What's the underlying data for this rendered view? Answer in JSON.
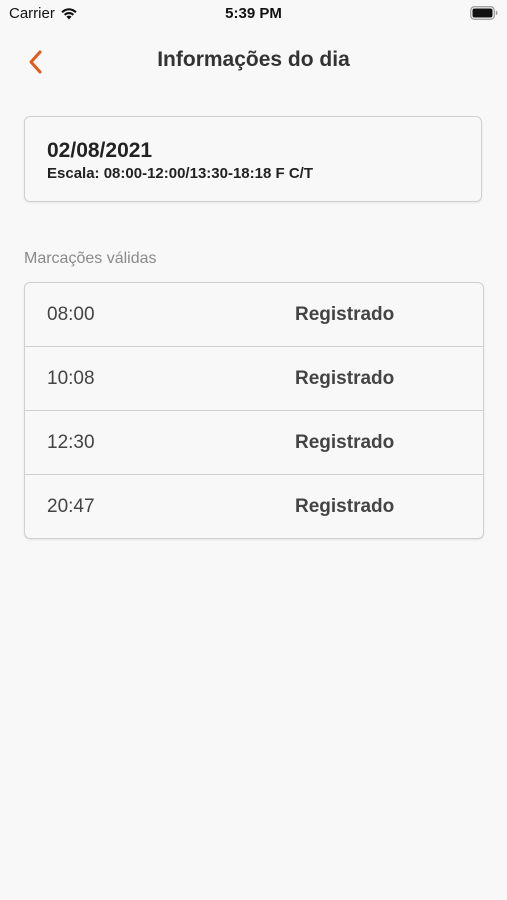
{
  "status_bar": {
    "carrier": "Carrier",
    "time": "5:39 PM",
    "icons": [
      "wifi-icon",
      "battery-icon"
    ]
  },
  "nav": {
    "title": "Informações do dia",
    "back_icon": "chevron-left-icon",
    "accent_color": "#e05a1e"
  },
  "info": {
    "date": "02/08/2021",
    "escala": "Escala: 08:00-12:00/13:30-18:18 F C/T"
  },
  "marcacoes": {
    "label": "Marcações válidas",
    "rows": [
      {
        "time": "08:00",
        "status": "Registrado"
      },
      {
        "time": "10:08",
        "status": "Registrado"
      },
      {
        "time": "12:30",
        "status": "Registrado"
      },
      {
        "time": "20:47",
        "status": "Registrado"
      }
    ]
  }
}
